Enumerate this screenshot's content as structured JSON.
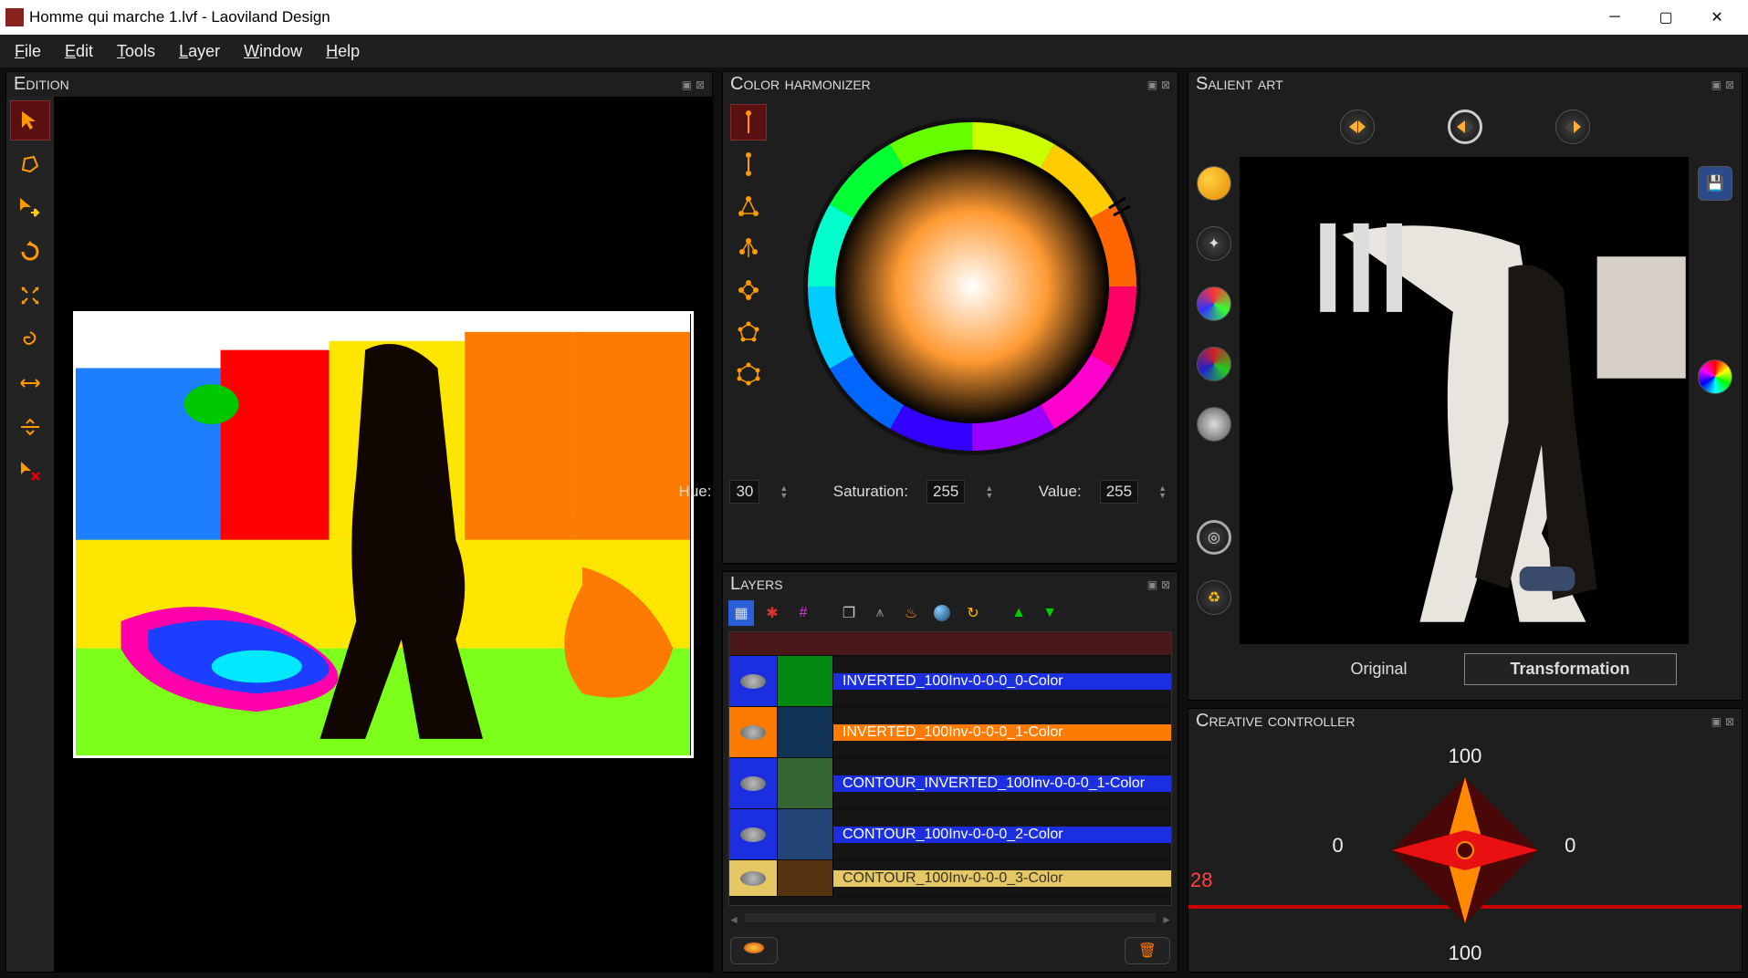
{
  "window": {
    "title": "Homme qui marche 1.lvf - Laoviland Design"
  },
  "menu": [
    "File",
    "Edit",
    "Tools",
    "Layer",
    "Window",
    "Help"
  ],
  "panels": {
    "edition": "Edition",
    "color_harmonizer": "Color harmonizer",
    "layers": "Layers",
    "salient_art": "Salient art",
    "creative_controller": "Creative controller"
  },
  "tools": [
    {
      "name": "pointer",
      "icon": "↖",
      "active": true
    },
    {
      "name": "polygon",
      "icon": "⬠",
      "active": false
    },
    {
      "name": "move",
      "icon": "↖⊕",
      "active": false
    },
    {
      "name": "rotate",
      "icon": "↻",
      "active": false
    },
    {
      "name": "scale",
      "icon": "✥",
      "active": false
    },
    {
      "name": "swirl",
      "icon": "֎",
      "active": false
    },
    {
      "name": "flip-h",
      "icon": "↔",
      "active": false
    },
    {
      "name": "flip-v",
      "icon": "↕",
      "active": false
    },
    {
      "name": "delete",
      "icon": "↖×",
      "active": false
    }
  ],
  "harmonizer": {
    "schemes": [
      "single",
      "complementary",
      "triad",
      "split",
      "square",
      "analogous",
      "polygon"
    ],
    "hue_label": "Hue:",
    "hue": "30",
    "sat_label": "Saturation:",
    "sat": "255",
    "val_label": "Value:",
    "val": "255"
  },
  "layers_tb": [
    "grid",
    "fx-r",
    "fx-m",
    "dup",
    "merge",
    "flame",
    "sphere",
    "cycle",
    "up",
    "down"
  ],
  "layers": [
    {
      "name": "INVERTED_100Inv-0-0-0_0-Color",
      "bg": "#1c2fe0",
      "vis": "#1c2fe0"
    },
    {
      "name": "INVERTED_100Inv-0-0-0_1-Color",
      "bg": "#ff7a00",
      "vis": "#ff7a00"
    },
    {
      "name": "CONTOUR_INVERTED_100Inv-0-0-0_1-Color",
      "bg": "#1c2fe0",
      "vis": "#1c2fe0"
    },
    {
      "name": "CONTOUR_100Inv-0-0-0_2-Color",
      "bg": "#1c2fe0",
      "vis": "#1c2fe0"
    },
    {
      "name": "CONTOUR_100Inv-0-0-0_3-Color",
      "bg": "#e6c766",
      "vis": "#e6c766"
    }
  ],
  "salient": {
    "original": "Original",
    "transformation": "Transformation"
  },
  "creative": {
    "top": "100",
    "left": "0",
    "right": "0",
    "bottom": "100",
    "track": "28"
  }
}
